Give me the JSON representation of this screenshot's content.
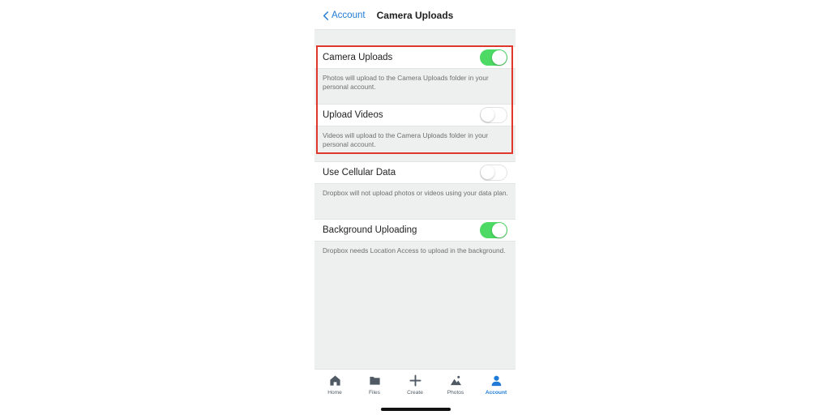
{
  "nav": {
    "back_label": "Account",
    "title": "Camera Uploads"
  },
  "settings": [
    {
      "label": "Camera Uploads",
      "enabled": true,
      "description": "Photos will upload to the Camera Uploads folder in your personal account."
    },
    {
      "label": "Upload Videos",
      "enabled": false,
      "description": "Videos will upload to the Camera Uploads folder in your personal account."
    },
    {
      "label": "Use Cellular Data",
      "enabled": false,
      "description": "Dropbox will not upload photos or videos using your data plan."
    },
    {
      "label": "Background Uploading",
      "enabled": true,
      "description": "Dropbox needs Location Access to upload in the background."
    }
  ],
  "tabs": [
    {
      "label": "Home",
      "icon": "home-icon"
    },
    {
      "label": "Files",
      "icon": "folder-icon"
    },
    {
      "label": "Create",
      "icon": "plus-icon"
    },
    {
      "label": "Photos",
      "icon": "photos-icon"
    },
    {
      "label": "Account",
      "icon": "person-icon",
      "active": true
    }
  ],
  "colors": {
    "accent": "#1f7bd6",
    "toggle_on": "#4cd964",
    "highlight_border": "#e0372c",
    "background": "#eef0ef"
  }
}
